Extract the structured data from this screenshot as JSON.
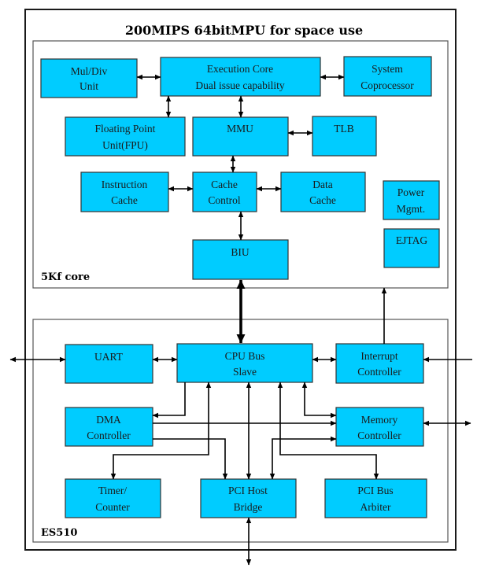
{
  "title": "200MIPS 64bitMPU for space use",
  "colors": {
    "block_fill": "#00CCFF",
    "block_border": "#333333",
    "line": "#000000"
  },
  "core": {
    "label": "5Kf core",
    "blocks": {
      "muldiv": [
        "Mul/Div",
        "Unit"
      ],
      "exec": [
        "Execution Core",
        "Dual issue capability"
      ],
      "syscop": [
        "System",
        "Coprocessor"
      ],
      "fpu": [
        "Floating Point",
        "Unit(FPU)"
      ],
      "mmu": [
        "MMU"
      ],
      "tlb": [
        "TLB"
      ],
      "icache": [
        "Instruction",
        "Cache"
      ],
      "cachectl": [
        "Cache",
        "Control"
      ],
      "dcache": [
        "Data",
        "Cache"
      ],
      "power": [
        "Power",
        "Mgmt."
      ],
      "ejtag": [
        "EJTAG"
      ],
      "biu": [
        "BIU"
      ]
    }
  },
  "soc": {
    "label": "ES510",
    "blocks": {
      "uart": [
        "UART"
      ],
      "cpubus": [
        "CPU Bus",
        "Slave"
      ],
      "intc": [
        "Interrupt",
        "Controller"
      ],
      "dma": [
        "DMA",
        "Controller"
      ],
      "memctl": [
        "Memory",
        "Controller"
      ],
      "timer": [
        "Timer/",
        "Counter"
      ],
      "pcihost": [
        "PCI Host",
        "Bridge"
      ],
      "arbiter": [
        "PCI Bus",
        "Arbiter"
      ]
    }
  }
}
